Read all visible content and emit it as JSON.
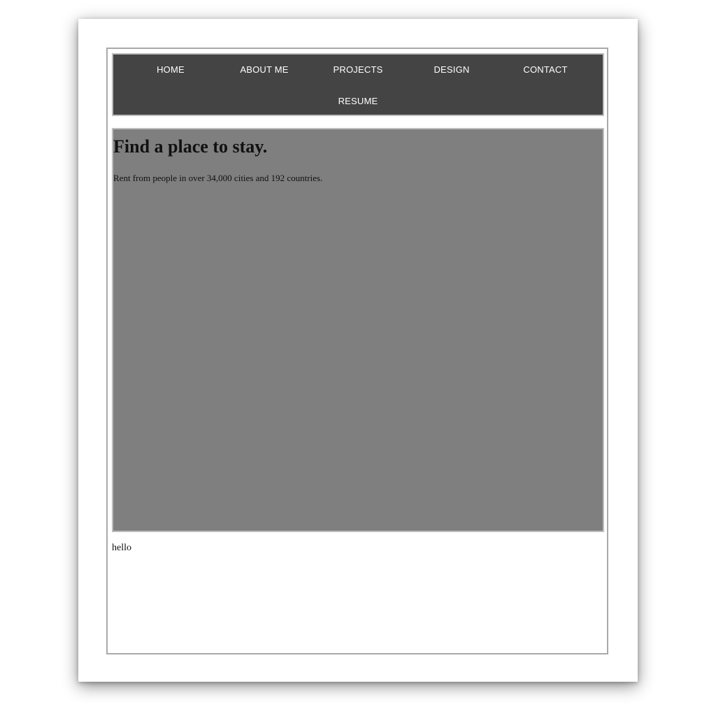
{
  "nav": {
    "items": [
      "HOME",
      "ABOUT ME",
      "PROJECTS",
      "DESIGN",
      "CONTACT",
      "RESUME"
    ]
  },
  "hero": {
    "title": "Find a place to stay.",
    "subtitle": "Rent from people in over 34,000 cities and 192 countries."
  },
  "footer": {
    "text": "hello"
  },
  "colors": {
    "nav_background": "#444444",
    "hero_background": "#7f7f7f",
    "page_background": "#ffffff"
  }
}
